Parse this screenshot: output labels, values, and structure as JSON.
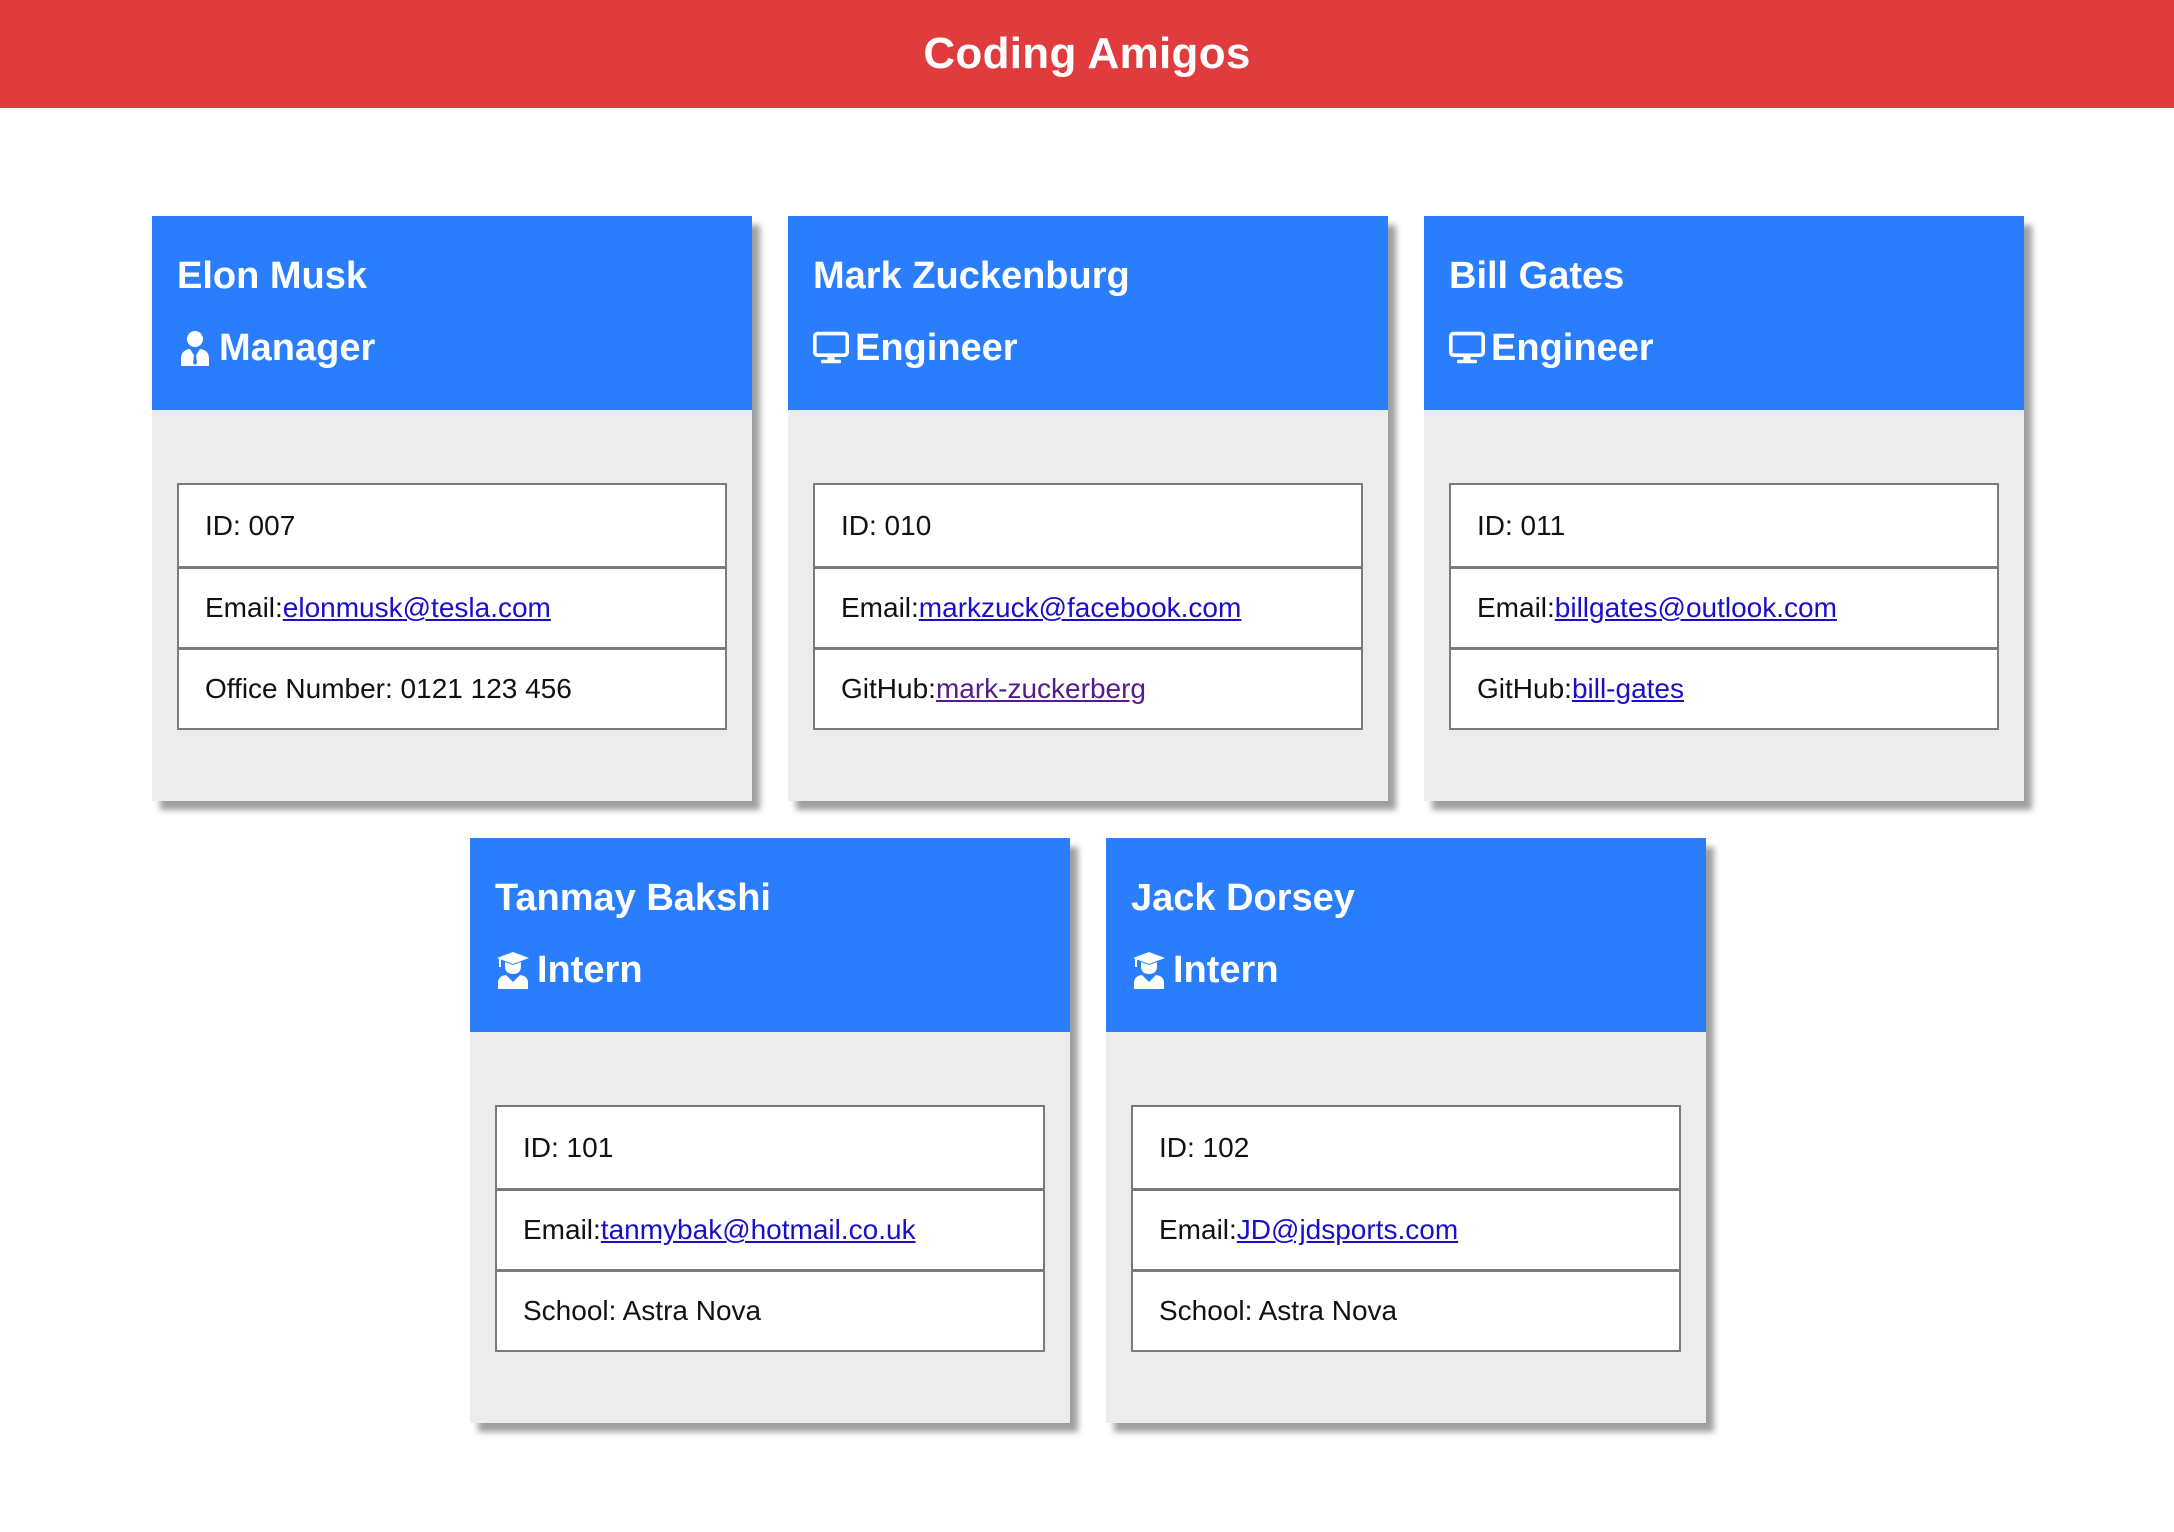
{
  "header": {
    "title": "Coding Amigos"
  },
  "team": [
    {
      "name": "Elon Musk",
      "role": "Manager",
      "role_icon": "user-tie-icon",
      "id_label": "ID: 007",
      "email_label": "Email:",
      "email": "elonmusk@tesla.com",
      "extra_label": "Office Number: 0121 123 456"
    },
    {
      "name": "Mark Zuckenburg",
      "role": "Engineer",
      "role_icon": "desktop-icon",
      "id_label": "ID: 010",
      "email_label": "Email:",
      "email": "markzuck@facebook.com",
      "extra_label": "GitHub:",
      "extra_link": "mark-zuckerberg"
    },
    {
      "name": "Bill Gates",
      "role": "Engineer",
      "role_icon": "desktop-icon",
      "id_label": "ID: 011",
      "email_label": "Email:",
      "email": "billgates@outlook.com",
      "extra_label": "GitHub:",
      "extra_link": "bill-gates"
    },
    {
      "name": "Tanmay Bakshi",
      "role": "Intern",
      "role_icon": "graduate-icon",
      "id_label": "ID: 101",
      "email_label": "Email:",
      "email": "tanmybak@hotmail.co.uk",
      "extra_label": "School: Astra Nova"
    },
    {
      "name": "Jack Dorsey",
      "role": "Intern",
      "role_icon": "graduate-icon",
      "id_label": "ID: 102",
      "email_label": "Email:",
      "email": "JD@jdsports.com",
      "extra_label": "School: Astra Nova"
    }
  ],
  "colors": {
    "header_bg": "#e13c3d",
    "card_header_bg": "#2a7efd",
    "card_body_bg": "#ececec",
    "link": "#1a0dcc",
    "link_visited": "#551a8b"
  }
}
